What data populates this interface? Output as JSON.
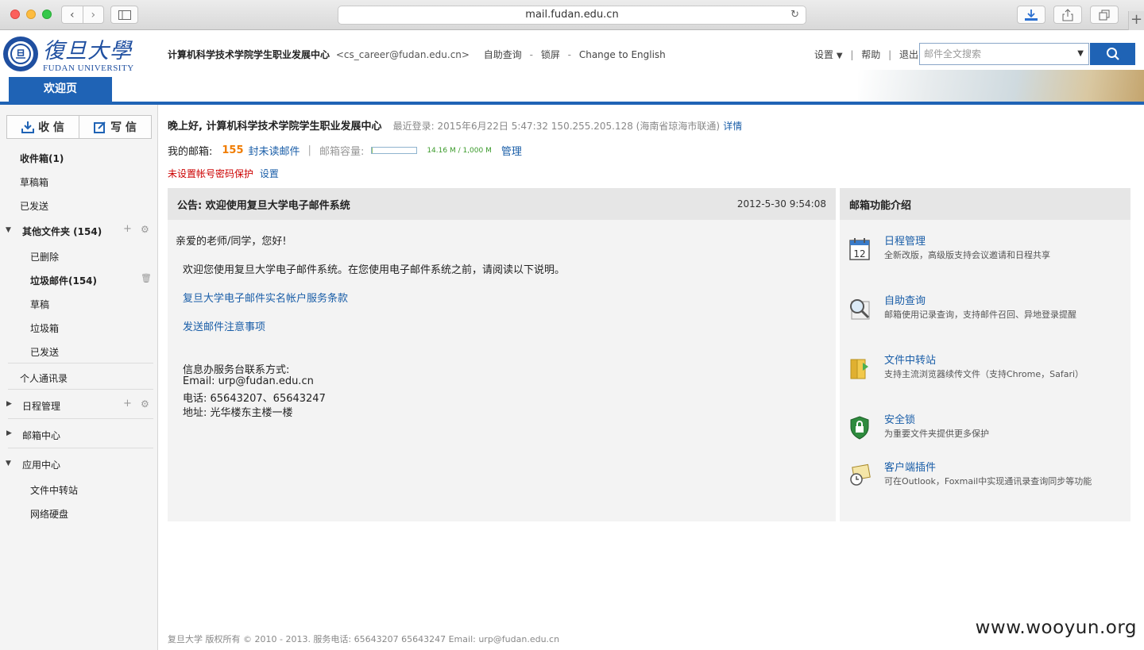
{
  "browser": {
    "url": "mail.fudan.edu.cn",
    "new_tab_symbol": "+"
  },
  "header": {
    "logo_text": "FUDAN UNIVERSITY",
    "logo_cn": "復旦大學",
    "welcome_tab": "欢迎页",
    "account_name": "计算机科学技术学院学生职业发展中心",
    "account_email": "<cs_career@fudan.edu.cn>",
    "self_query": "自助查询",
    "lock": "锁屏",
    "english": "Change to English",
    "dash": "-",
    "settings": "设置",
    "help": "帮助",
    "logout": "退出",
    "separator": "|",
    "search_placeholder": "邮件全文搜索"
  },
  "sidebar": {
    "receive": "收 信",
    "compose": "写 信",
    "inbox": "收件箱(1)",
    "drafts": "草稿箱",
    "sent": "已发送",
    "other_folders": "其他文件夹 (154)",
    "sub_deleted": "已删除",
    "sub_spam": "垃圾邮件(154)",
    "sub_drafts": "草稿",
    "sub_trash": "垃圾箱",
    "sub_sent": "已发送",
    "contacts": "个人通讯录",
    "calendar": "日程管理",
    "mail_center": "邮箱中心",
    "app_center": "应用中心",
    "file_transfer": "文件中转站",
    "net_disk": "网络硬盘"
  },
  "main": {
    "greeting": "晚上好, 计算机科学技术学院学生职业发展中心",
    "last_login": "最近登录: 2015年6月22日 5:47:32 150.255.205.128 (海南省琼海市联通)",
    "details": "详情",
    "mybox_label": "我的邮箱:",
    "unread_count": "155",
    "unread_text": "封未读邮件",
    "sep": "|",
    "capacity_label": "邮箱容量:",
    "capacity_value": "14.16 M / 1,000 M",
    "capacity_fraction": 0.01416,
    "manage": "管理",
    "warning": "未设置帐号密码保护",
    "setup": "设置"
  },
  "announcement": {
    "title": "公告: 欢迎使用复旦大学电子邮件系统",
    "date": "2012-5-30 9:54:08",
    "salutation": "亲爱的老师/同学，您好!",
    "intro": "欢迎您使用复旦大学电子邮件系统。在您使用电子邮件系统之前，请阅读以下说明。",
    "link1": "复旦大学电子邮件实名帐户服务条款",
    "link2": "发送邮件注意事项",
    "contact_title": "信息办服务台联系方式:",
    "email_line": "Email: urp@fudan.edu.cn",
    "phone_line": "电话: 65643207、65643247",
    "address_line": "地址: 光华楼东主楼一楼"
  },
  "features": {
    "title": "邮箱功能介绍",
    "items": [
      {
        "name": "日程管理",
        "desc": "全新改版，高级版支持会议邀请和日程共享",
        "icon": "calendar-icon",
        "icon_text": "12"
      },
      {
        "name": "自助查询",
        "desc": "邮箱使用记录查询，支持邮件召回、异地登录提醒",
        "icon": "magnifier-icon"
      },
      {
        "name": "文件中转站",
        "desc": "支持主流浏览器续传文件（支持Chrome，Safari）",
        "icon": "folder-transfer-icon"
      },
      {
        "name": "安全锁",
        "desc": "为重要文件夹提供更多保护",
        "icon": "shield-lock-icon"
      },
      {
        "name": "客户端插件",
        "desc": "可在Outlook，Foxmail中实现通讯录查询同步等功能",
        "icon": "plugin-icon"
      }
    ]
  },
  "footer": "复旦大学 版权所有 © 2010 - 2013. 服务电话: 65643207 65643247 Email: urp@fudan.edu.cn",
  "watermark": "www.wooyun.org"
}
